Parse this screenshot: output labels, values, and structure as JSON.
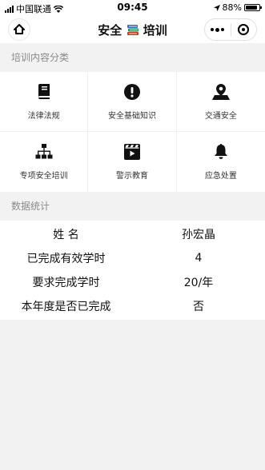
{
  "status_bar": {
    "carrier": "中国联通",
    "time": "09:45",
    "battery": "88%",
    "battery_level": 0.88,
    "icons": [
      "signal-icon",
      "wifi-icon",
      "location-arrow-icon",
      "battery-icon"
    ]
  },
  "nav": {
    "title_left": "安全",
    "title_right": "培训",
    "title_icon": "books-icon",
    "home_icon": "home-icon",
    "more_icon": "more-dots-icon",
    "close_icon": "close-circle-icon"
  },
  "categories": {
    "section_title": "培训内容分类",
    "items": [
      {
        "label": "法律法规",
        "icon": "book-icon"
      },
      {
        "label": "安全基础知识",
        "icon": "exclamation-circle-icon"
      },
      {
        "label": "交通安全",
        "icon": "map-marker-icon"
      },
      {
        "label": "专项安全培训",
        "icon": "sitemap-icon"
      },
      {
        "label": "警示教育",
        "icon": "film-icon"
      },
      {
        "label": "应急处置",
        "icon": "bell-icon"
      }
    ]
  },
  "stats": {
    "section_title": "数据统计",
    "rows": [
      {
        "key": "姓 名",
        "value": "孙宏晶"
      },
      {
        "key": "已完成有效学时",
        "value": "4"
      },
      {
        "key": "要求完成学时",
        "value": "20/年"
      },
      {
        "key": "本年度是否已完成",
        "value": "否"
      }
    ]
  },
  "colors": {
    "background": "#f2f2f2",
    "card": "#ffffff",
    "section_text": "#8a8a8a",
    "icon": "#111111"
  }
}
